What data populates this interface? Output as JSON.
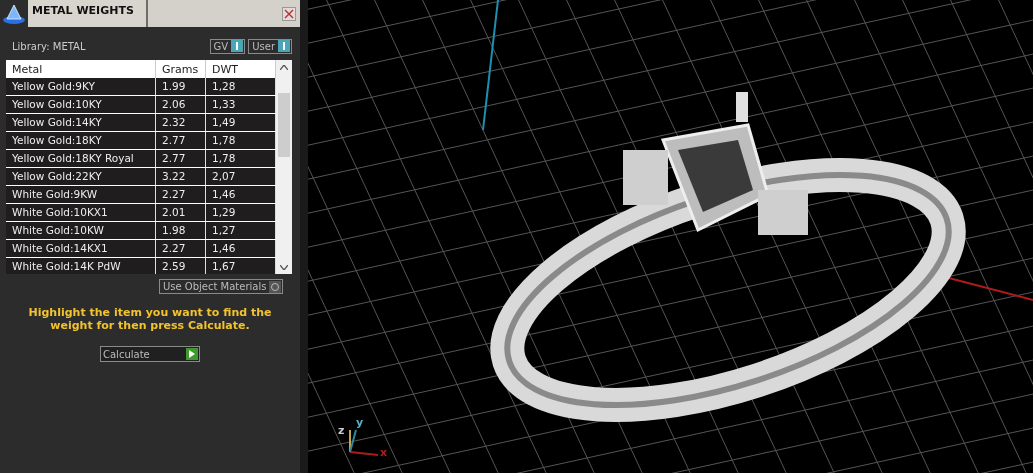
{
  "panel": {
    "title": "METAL WEIGHTS",
    "library_label": "Library: METAL",
    "toggles": [
      {
        "label": "GV",
        "on": true
      },
      {
        "label": "User",
        "on": true
      }
    ],
    "table": {
      "columns": [
        "Metal",
        "Grams",
        "DWT"
      ],
      "rows": [
        [
          "Yellow Gold:9KY",
          "1.99",
          "1,28"
        ],
        [
          "Yellow Gold:10KY",
          "2.06",
          "1,33"
        ],
        [
          "Yellow Gold:14KY",
          "2.32",
          "1,49"
        ],
        [
          "Yellow Gold:18KY",
          "2.77",
          "1,78"
        ],
        [
          "Yellow Gold:18KY Royal",
          "2.77",
          "1,78"
        ],
        [
          "Yellow Gold:22KY",
          "3.22",
          "2,07"
        ],
        [
          "White Gold:9KW",
          "2.27",
          "1,46"
        ],
        [
          "White Gold:10KX1",
          "2.01",
          "1,29"
        ],
        [
          "White Gold:10KW",
          "1.98",
          "1,27"
        ],
        [
          "White Gold:14KX1",
          "2.27",
          "1,46"
        ],
        [
          "White Gold:14K PdW",
          "2.59",
          "1,67"
        ]
      ]
    },
    "use_object_materials": {
      "label": "Use Object Materials",
      "on": false
    },
    "hint": "Highlight the item you want to find the weight for then press Calculate.",
    "calculate_button": "Calculate"
  },
  "viewport": {
    "axes": {
      "x": "x",
      "y": "y",
      "z": "z"
    }
  }
}
